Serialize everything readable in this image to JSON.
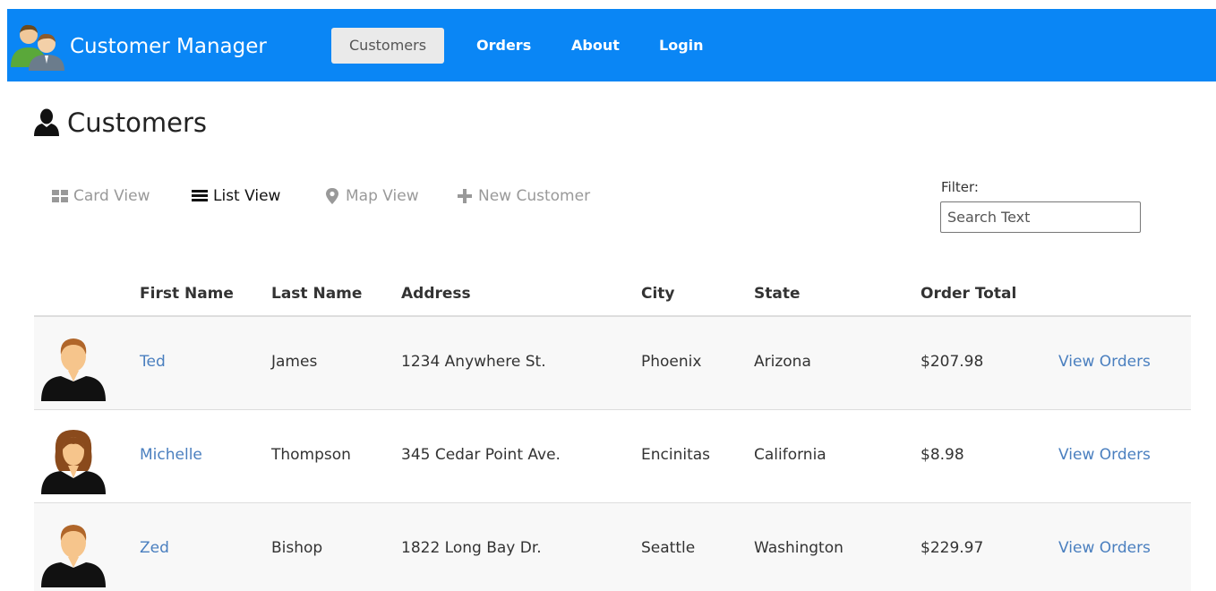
{
  "app": {
    "title": "Customer Manager"
  },
  "nav": {
    "items": [
      {
        "label": "Customers",
        "active": true
      },
      {
        "label": "Orders",
        "active": false
      },
      {
        "label": "About",
        "active": false
      },
      {
        "label": "Login",
        "active": false
      }
    ]
  },
  "page": {
    "title": "Customers"
  },
  "views": {
    "card": "Card View",
    "list": "List View",
    "map": "Map View",
    "new_customer": "New Customer",
    "active": "list"
  },
  "filter": {
    "label": "Filter:",
    "placeholder": "Search Text",
    "value": ""
  },
  "table": {
    "columns": [
      "First Name",
      "Last Name",
      "Address",
      "City",
      "State",
      "Order Total"
    ],
    "rows": [
      {
        "avatar": "male",
        "first": "Ted",
        "last": "James",
        "address": "1234 Anywhere St.",
        "city": "Phoenix",
        "state": "Arizona",
        "total": "$207.98",
        "action": "View Orders"
      },
      {
        "avatar": "female",
        "first": "Michelle",
        "last": "Thompson",
        "address": "345 Cedar Point Ave.",
        "city": "Encinitas",
        "state": "California",
        "total": "$8.98",
        "action": "View Orders"
      },
      {
        "avatar": "male",
        "first": "Zed",
        "last": "Bishop",
        "address": "1822 Long Bay Dr.",
        "city": "Seattle",
        "state": "Washington",
        "total": "$229.97",
        "action": "View Orders"
      }
    ]
  },
  "icons": {
    "brand": "people-icon",
    "page": "user-icon",
    "card_view": "grid-icon",
    "list_view": "list-icon",
    "map_view": "map-marker-icon",
    "new_customer": "plus-icon"
  },
  "colors": {
    "navbar": "#0a86f5",
    "link": "#4a7fbf",
    "muted": "#999999"
  }
}
